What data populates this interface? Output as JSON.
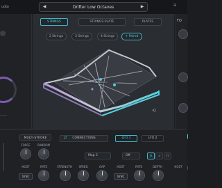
{
  "header": {
    "left_label": "udio",
    "preset_name": "Drifter Low Octaves",
    "prev_arrow": "◀",
    "next_arrow": "▶",
    "right_icon": "⊞"
  },
  "right_panel": {
    "label": "FO"
  },
  "tabs": [
    {
      "label": "STRINGS",
      "active": true
    },
    {
      "label": "STRINGS-PLATE",
      "active": false
    },
    {
      "label": "PLATES",
      "active": false
    }
  ],
  "modes": [
    {
      "label": "2 Strings",
      "active": false
    },
    {
      "label": "3 Strings",
      "active": false
    },
    {
      "label": "4 Strings",
      "active": false
    },
    {
      "label": "+ Paired",
      "active": true
    }
  ],
  "bottom": {
    "multi_stroke_label": "MULTI-STROKE",
    "connections_label": "CONNECTIONS",
    "lfo1_label": "LFO 1",
    "lfo2_label": "LFO 2",
    "force_label": "FORCE",
    "random_label": "RANDOM",
    "host_label_1": "HOST",
    "rate_label_1": "RATE",
    "sync_label_1": "SYNC",
    "map_select": "Map 3",
    "off_select": "Off",
    "strength_label": "STRENGTH",
    "speed_label": "SPEED",
    "gap_label": "GAP",
    "host_label_2": "HOST",
    "rate_label_2": "RATE",
    "depth_label": "DEPTH",
    "sync_label_2": "SYNC",
    "host_label_3": "HOST"
  },
  "colors": {
    "accent": "#52d0e2",
    "background": "#1b1d21",
    "panel": "#2a2d32",
    "purple": "#7d5cae"
  }
}
